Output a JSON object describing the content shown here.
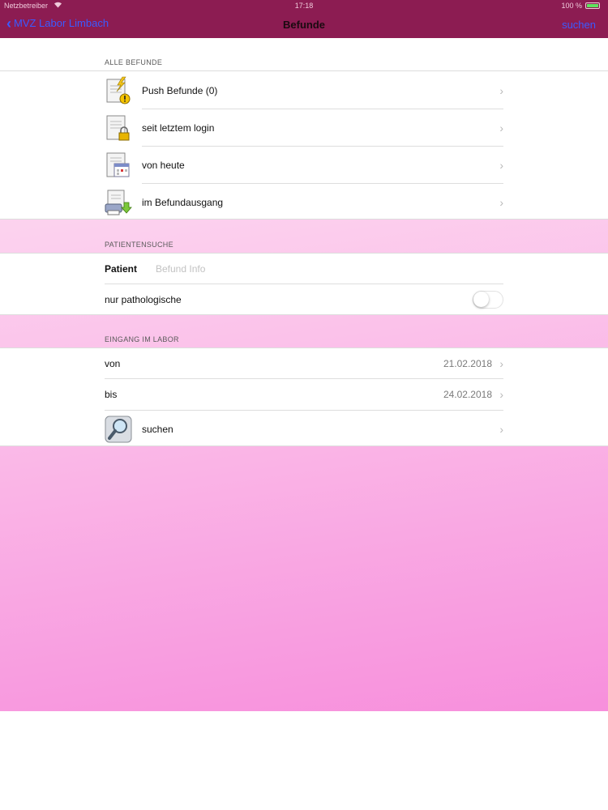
{
  "status_bar": {
    "carrier": "Netzbetreiber",
    "time": "17:18",
    "battery": "100 %"
  },
  "nav": {
    "back_label": "MVZ Labor Limbach",
    "title": "Befunde",
    "action_label": "suchen"
  },
  "alle_befunde": {
    "header": "ALLE BEFUNDE",
    "items": [
      {
        "label": "Push Befunde (0)",
        "icon": "document-lightning-warning-icon"
      },
      {
        "label": "seit letztem login",
        "icon": "document-lock-icon"
      },
      {
        "label": "von heute",
        "icon": "document-calendar-icon"
      },
      {
        "label": "im Befundausgang",
        "icon": "document-printer-download-icon"
      }
    ]
  },
  "patientensuche": {
    "header": "PATIENTENSUCHE",
    "patient_label": "Patient",
    "patient_placeholder": "Befund Info",
    "pathologic_label": "nur pathologische",
    "pathologic_enabled": false
  },
  "eingang": {
    "header": "EINGANG IM LABOR",
    "from_label": "von",
    "from_value": "21.02.2018",
    "to_label": "bis",
    "to_value": "24.02.2018",
    "search_label": "suchen",
    "search_icon": "magnifier-icon"
  },
  "colors": {
    "nav_background": "#8c1c52",
    "link": "#3b5bff",
    "gradient_start": "#fde6f4",
    "gradient_end": "#f78fdc"
  }
}
